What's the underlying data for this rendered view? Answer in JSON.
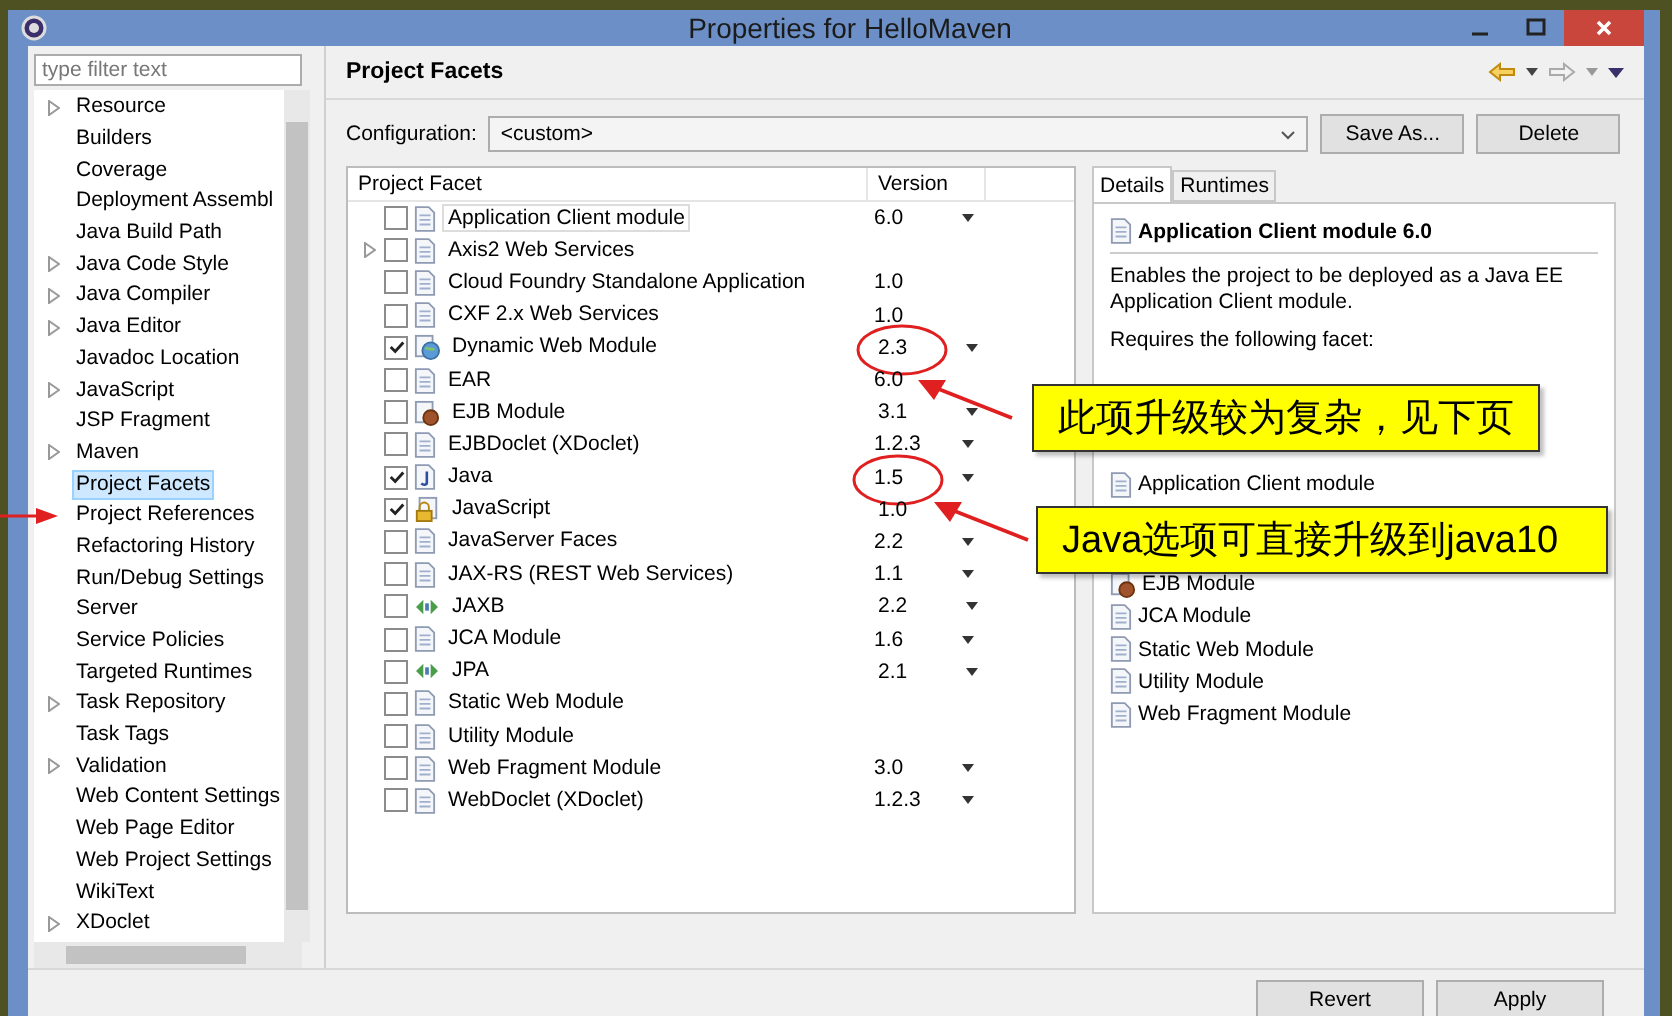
{
  "window": {
    "title": "Properties for HelloMaven"
  },
  "sidebar": {
    "filter_placeholder": "type filter text",
    "items": [
      {
        "label": "Resource",
        "expandable": true,
        "selected": false
      },
      {
        "label": "Builders",
        "expandable": false,
        "selected": false
      },
      {
        "label": "Coverage",
        "expandable": false,
        "selected": false
      },
      {
        "label": "Deployment Assembl",
        "expandable": false,
        "selected": false
      },
      {
        "label": "Java Build Path",
        "expandable": false,
        "selected": false
      },
      {
        "label": "Java Code Style",
        "expandable": true,
        "selected": false
      },
      {
        "label": "Java Compiler",
        "expandable": true,
        "selected": false
      },
      {
        "label": "Java Editor",
        "expandable": true,
        "selected": false
      },
      {
        "label": "Javadoc Location",
        "expandable": false,
        "selected": false
      },
      {
        "label": "JavaScript",
        "expandable": true,
        "selected": false
      },
      {
        "label": "JSP Fragment",
        "expandable": false,
        "selected": false
      },
      {
        "label": "Maven",
        "expandable": true,
        "selected": false
      },
      {
        "label": "Project Facets",
        "expandable": false,
        "selected": true
      },
      {
        "label": "Project References",
        "expandable": false,
        "selected": false
      },
      {
        "label": "Refactoring History",
        "expandable": false,
        "selected": false
      },
      {
        "label": "Run/Debug Settings",
        "expandable": false,
        "selected": false
      },
      {
        "label": "Server",
        "expandable": false,
        "selected": false
      },
      {
        "label": "Service Policies",
        "expandable": false,
        "selected": false
      },
      {
        "label": "Targeted Runtimes",
        "expandable": false,
        "selected": false
      },
      {
        "label": "Task Repository",
        "expandable": true,
        "selected": false
      },
      {
        "label": "Task Tags",
        "expandable": false,
        "selected": false
      },
      {
        "label": "Validation",
        "expandable": true,
        "selected": false
      },
      {
        "label": "Web Content Settings",
        "expandable": false,
        "selected": false
      },
      {
        "label": "Web Page Editor",
        "expandable": false,
        "selected": false
      },
      {
        "label": "Web Project Settings",
        "expandable": false,
        "selected": false
      },
      {
        "label": "WikiText",
        "expandable": false,
        "selected": false
      },
      {
        "label": "XDoclet",
        "expandable": true,
        "selected": false
      }
    ]
  },
  "page": {
    "title": "Project Facets",
    "configuration": {
      "label": "Configuration:",
      "value": "<custom>"
    },
    "buttons": [
      "Save As...",
      "Delete"
    ],
    "facets_table": {
      "columns": [
        "Project Facet",
        "Version"
      ],
      "rows": [
        {
          "name": "Application Client module",
          "checked": false,
          "selected": true,
          "expandable": false,
          "kind": "doc",
          "version": "6.0",
          "has_dropdown": true,
          "circled": false
        },
        {
          "name": "Axis2 Web Services",
          "checked": false,
          "selected": false,
          "expandable": true,
          "kind": "doc",
          "has_dropdown": false,
          "circled": false
        },
        {
          "name": "Cloud Foundry Standalone Application",
          "checked": false,
          "selected": false,
          "expandable": false,
          "kind": "doc",
          "version": "1.0",
          "has_dropdown": false,
          "circled": false
        },
        {
          "name": "CXF 2.x Web Services",
          "checked": false,
          "selected": false,
          "expandable": false,
          "kind": "doc",
          "version": "1.0",
          "has_dropdown": false,
          "circled": false
        },
        {
          "name": "Dynamic Web Module",
          "checked": true,
          "selected": false,
          "expandable": false,
          "kind": "globe",
          "version": "2.3",
          "has_dropdown": true,
          "circled": true
        },
        {
          "name": "EAR",
          "checked": false,
          "selected": false,
          "expandable": false,
          "kind": "doc",
          "version": "6.0",
          "has_dropdown": false,
          "circled": false
        },
        {
          "name": "EJB Module",
          "checked": false,
          "selected": false,
          "expandable": false,
          "kind": "bean",
          "version": "3.1",
          "has_dropdown": true,
          "circled": false
        },
        {
          "name": "EJBDoclet (XDoclet)",
          "checked": false,
          "selected": false,
          "expandable": false,
          "kind": "doc",
          "version": "1.2.3",
          "has_dropdown": true,
          "circled": false
        },
        {
          "name": "Java",
          "checked": true,
          "selected": false,
          "expandable": false,
          "kind": "java",
          "version": "1.5",
          "has_dropdown": true,
          "circled": true
        },
        {
          "name": "JavaScript",
          "checked": true,
          "selected": false,
          "expandable": false,
          "kind": "lock",
          "version": "1.0",
          "has_dropdown": false,
          "circled": false
        },
        {
          "name": "JavaServer Faces",
          "checked": false,
          "selected": false,
          "expandable": false,
          "kind": "doc",
          "version": "2.2",
          "has_dropdown": true,
          "circled": false
        },
        {
          "name": "JAX-RS (REST Web Services)",
          "checked": false,
          "selected": false,
          "expandable": false,
          "kind": "doc",
          "version": "1.1",
          "has_dropdown": true,
          "circled": false
        },
        {
          "name": "JAXB",
          "checked": false,
          "selected": false,
          "expandable": false,
          "kind": "arrows",
          "version": "2.2",
          "has_dropdown": true,
          "circled": false
        },
        {
          "name": "JCA Module",
          "checked": false,
          "selected": false,
          "expandable": false,
          "kind": "doc",
          "version": "1.6",
          "has_dropdown": true,
          "circled": false
        },
        {
          "name": "JPA",
          "checked": false,
          "selected": false,
          "expandable": false,
          "kind": "arrows",
          "version": "2.1",
          "has_dropdown": true,
          "circled": false
        },
        {
          "name": "Static Web Module",
          "checked": false,
          "selected": false,
          "expandable": false,
          "kind": "doc",
          "has_dropdown": false,
          "circled": false
        },
        {
          "name": "Utility Module",
          "checked": false,
          "selected": false,
          "expandable": false,
          "kind": "doc",
          "has_dropdown": false,
          "circled": false
        },
        {
          "name": "Web Fragment Module",
          "checked": false,
          "selected": false,
          "expandable": false,
          "kind": "doc",
          "version": "3.0",
          "has_dropdown": true,
          "circled": false
        },
        {
          "name": "WebDoclet (XDoclet)",
          "checked": false,
          "selected": false,
          "expandable": false,
          "kind": "doc",
          "version": "1.2.3",
          "has_dropdown": true,
          "circled": false
        }
      ]
    },
    "details": {
      "tabs": [
        {
          "label": "Details",
          "selected": true
        },
        {
          "label": "Runtimes",
          "selected": false
        }
      ],
      "title": "Application Client module 6.0",
      "description": "Enables the project to be deployed as a Java EE Application Client module.",
      "requires_label": "Requires the following facet:",
      "conflicts_visible_top": [
        {
          "name": "Application Client module",
          "kind": "doc"
        }
      ],
      "conflicts_visible_bottom": [
        {
          "name": "EJB Module",
          "kind": "bean"
        },
        {
          "name": "JCA Module",
          "kind": "doc"
        },
        {
          "name": "Static Web Module",
          "kind": "doc"
        },
        {
          "name": "Utility Module",
          "kind": "doc"
        },
        {
          "name": "Web Fragment Module",
          "kind": "doc"
        }
      ]
    }
  },
  "footer_buttons": [
    "Revert",
    "Apply"
  ],
  "annotations": [
    {
      "text": "此项升级较为复杂，见下页"
    },
    {
      "text": "Java选项可直接升级到java10"
    }
  ]
}
